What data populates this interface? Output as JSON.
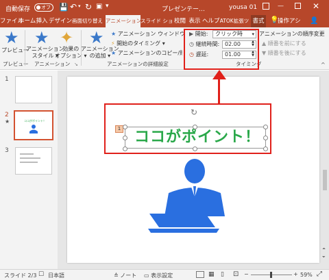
{
  "titlebar": {
    "autosave": "自動保存",
    "autosave_state": "オフ",
    "doc_title": "プレゼンテー…",
    "user": "yousa 01"
  },
  "tabs": [
    "ファイル",
    "ホーム",
    "挿入",
    "デザイン",
    "画面切り替え",
    "アニメーション",
    "スライド ショー",
    "校閲",
    "表示",
    "ヘルプ",
    "ATOK拡張ツ",
    "書式"
  ],
  "tell_me": "操作アシ",
  "ribbon": {
    "preview": "プレビュー",
    "preview_group": "プレビュー",
    "anim_style": "アニメーション\nスタイル ▾",
    "effect_opts": "効果の\nオプション ▾",
    "anim_group": "アニメーション",
    "add_anim": "アニメーション\nの追加 ▾",
    "anim_window": "アニメーション ウィンドウ",
    "trigger": "開始のタイミング ▾",
    "anim_painter": "アニメーションのコピー/貼り付け",
    "advanced_group": "アニメーションの詳細設定",
    "start_label": "開始:",
    "start_value": "クリック時",
    "duration_label": "継続時間:",
    "duration_value": "02.00",
    "delay_label": "遅延:",
    "delay_value": "01.00",
    "timing_group": "タイミング",
    "reorder_title": "アニメーションの順序変更",
    "move_earlier": "順番を前にする",
    "move_later": "順番を後にする"
  },
  "slides": [
    {
      "num": "1",
      "star": ""
    },
    {
      "num": "2",
      "star": "★",
      "thumb_text": "ココがポイント！"
    },
    {
      "num": "3",
      "star": ""
    }
  ],
  "slide": {
    "text": "ココがポイント！",
    "anim_tag": "1"
  },
  "status": {
    "slide_info": "スライド 2/3",
    "language": "日本語",
    "notes": "ノート",
    "display_settings": "表示設定",
    "zoom": "59%"
  },
  "colors": {
    "accent": "#b7472a",
    "highlight": "#e0201a",
    "slide_text": "#2aa84a",
    "figure": "#2a6fe0"
  }
}
